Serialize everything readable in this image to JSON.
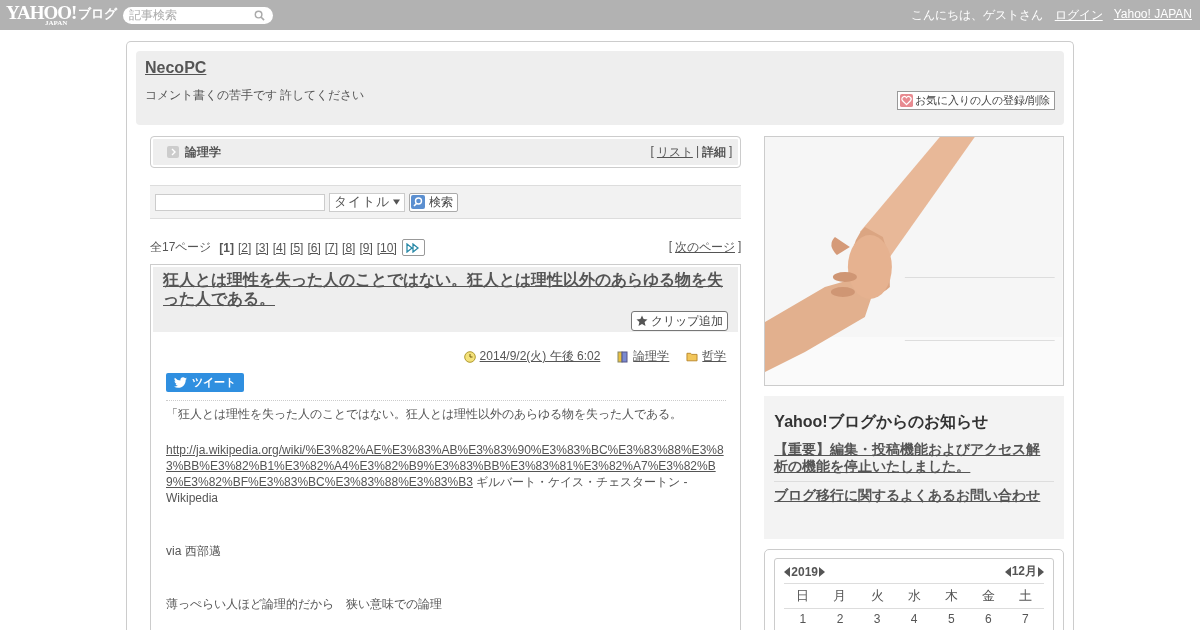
{
  "topbar": {
    "logo": "YAHOO!",
    "logo_sub": "JAPAN",
    "service": "ブログ",
    "search": {
      "placeholder": "記事検索"
    },
    "greeting": "こんにちは、ゲストさん",
    "links": [
      "ログイン",
      "Yahoo! JAPAN"
    ]
  },
  "blog": {
    "title": "NecoPC",
    "description": "コメント書くの苦手です 許してください",
    "favorite_button": "お気に入りの人の登録/削除"
  },
  "category": {
    "name": "論理学",
    "open": "[",
    "separator": "|",
    "close": "]",
    "views": [
      {
        "label": "リスト",
        "selected": false
      },
      {
        "label": "詳細",
        "selected": true
      }
    ]
  },
  "search": {
    "scope": "タイトル",
    "button": "検索"
  },
  "pagination": {
    "total": "全17ページ",
    "pages": [
      {
        "label": "[1]",
        "selected": true
      },
      {
        "label": "[2]",
        "selected": false
      },
      {
        "label": "[3]",
        "selected": false
      },
      {
        "label": "[4]",
        "selected": false
      },
      {
        "label": "[5]",
        "selected": false
      },
      {
        "label": "[6]",
        "selected": false
      },
      {
        "label": "[7]",
        "selected": false
      },
      {
        "label": "[8]",
        "selected": false
      },
      {
        "label": "[9]",
        "selected": false
      },
      {
        "label": "[10]",
        "selected": false
      }
    ],
    "next_open": "[",
    "next": "次のページ",
    "next_close": "]"
  },
  "post": {
    "title": "狂人とは理性を失った人のことではない。狂人とは理性以外のあらゆる物を失った人である。",
    "clip_button": "クリップ追加",
    "date": "2014/9/2(火) 午後 6:02",
    "category": "論理学",
    "folder": "哲学",
    "tweet_button": "ツイート",
    "body": [
      {
        "kind": "text",
        "text": "「狂人とは理性を失った人のことではない。狂人とは理性以外のあらゆる物を失った人である。"
      },
      {
        "kind": "link",
        "link": "http://ja.wikipedia.org/wiki/%E3%82%AE%E3%83%AB%E3%83%90%E3%83%BC%E3%83%88%E3%83%BB%E3%82%B1%E3%82%A4%E3%82%B9%E3%83%BB%E3%83%81%E3%82%A7%E3%82%B9%E3%82%BF%E3%83%BC%E3%83%88%E3%83%B3",
        "text": "ギルバート・ケイス・チェスタートン - Wikipedia"
      },
      {
        "kind": "text",
        "text": "via 西部邁"
      },
      {
        "kind": "text",
        "text": "薄っぺらい人ほど論理的だから　狭い意味での論理"
      }
    ]
  },
  "notices": {
    "title": "Yahoo!ブログからのお知らせ",
    "items": [
      "【重要】編集・投稿機能およびアクセス解析の機能を停止いたしました。",
      "ブログ移行に関するよくあるお問い合わせ"
    ]
  },
  "calendar": {
    "year": "2019",
    "month": "12月",
    "weekdays": [
      "日",
      "月",
      "火",
      "水",
      "木",
      "金",
      "土"
    ],
    "days": [
      "1",
      "2",
      "3",
      "4",
      "5",
      "6",
      "7"
    ]
  }
}
